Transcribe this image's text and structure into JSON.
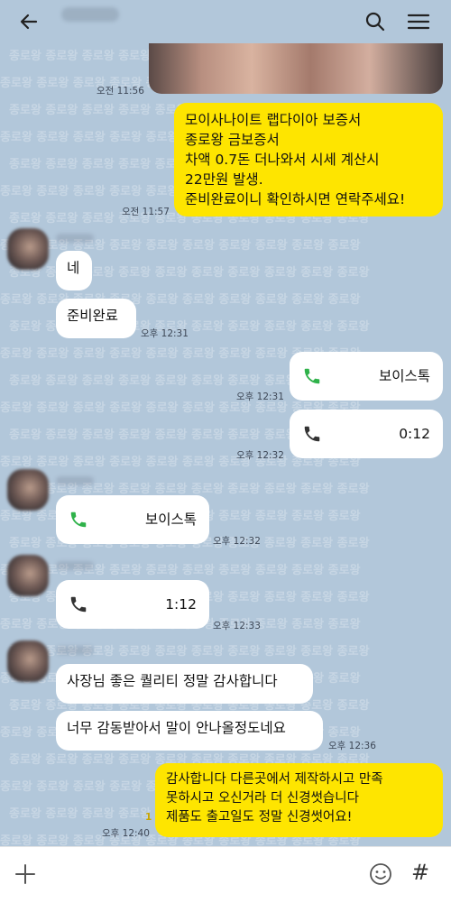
{
  "watermark": {
    "text": "종로왕"
  },
  "header": {
    "back_icon": "arrow-left-icon",
    "search_icon": "search-icon",
    "menu_icon": "hamburger-menu-icon"
  },
  "messages": {
    "m1_time": "오전 11:56",
    "m2": {
      "lines": [
        "모이사나이트 랩다이아 보증서",
        "종로왕 금보증서",
        "차액 0.7돈 더나와서 시세 계산시",
        "22만원 발생.",
        "준비완료이니 확인하시면 연락주세요!"
      ],
      "time": "오전 11:57"
    },
    "m3": {
      "text": "네"
    },
    "m4": {
      "text": "준비완료",
      "time": "오후 12:31"
    },
    "m5": {
      "text": "보이스톡",
      "time": "오후 12:31"
    },
    "m6": {
      "text": "0:12",
      "time": "오후 12:32"
    },
    "m7": {
      "text": "보이스톡",
      "time": "오후 12:32"
    },
    "m8": {
      "text": "1:12",
      "time": "오후 12:33"
    },
    "m9": {
      "text": "사장님 좋은 퀄리티 정말 감사합니다"
    },
    "m10": {
      "text": "너무 감동받아서 말이 안나올정도네요",
      "time": "오후 12:36"
    },
    "m11": {
      "lines": [
        "감사합니다 다른곳에서 제작하시고 만족",
        "못하시고 오신거라 더 신경썻습니다",
        "제품도 출고일도 정말 신경썻어요!"
      ],
      "time": "오후 12:40",
      "unread": "1"
    }
  },
  "bottom": {
    "input_value": "",
    "plus_icon": "plus-icon",
    "emoji_icon": "emoji-icon",
    "hash_label": "#"
  },
  "colors": {
    "background": "#b2c7da",
    "my_bubble": "#fee500",
    "their_bubble": "#ffffff",
    "phone_green": "#2fb24a",
    "phone_dark": "#333333"
  }
}
